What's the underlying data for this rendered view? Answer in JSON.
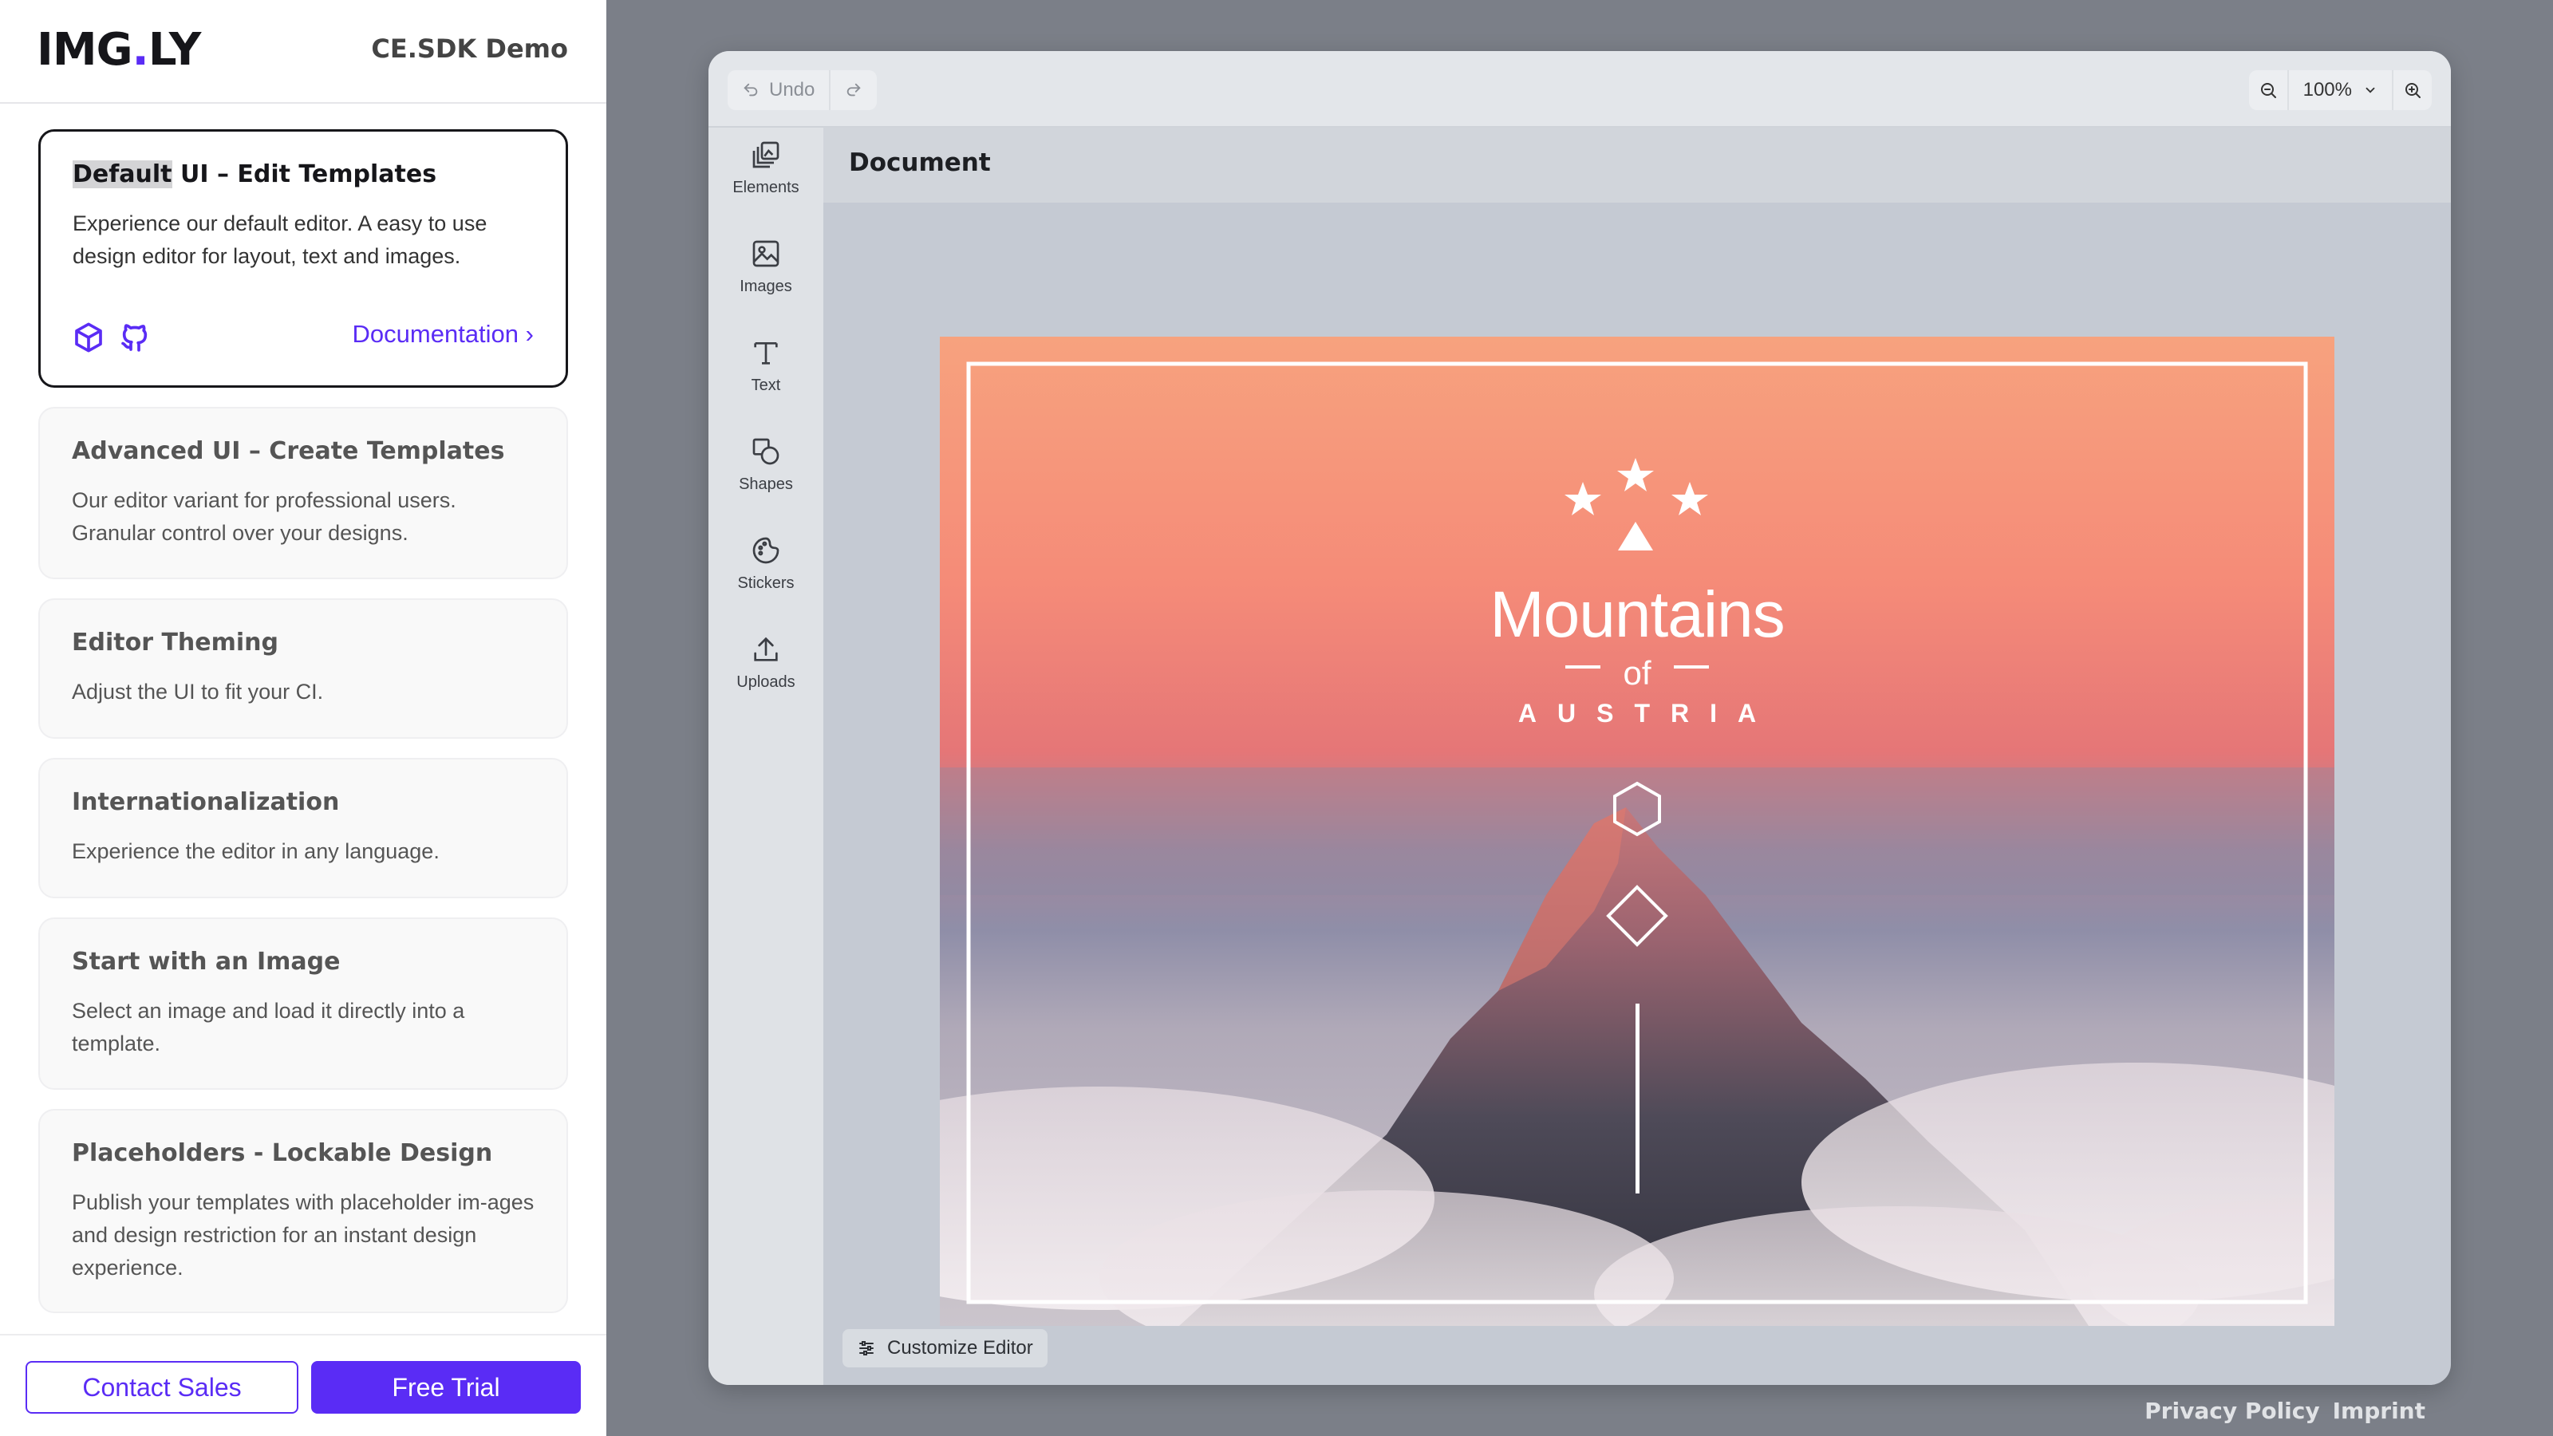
{
  "sidebar": {
    "logo": {
      "text_main": "IMG",
      "text_dot": ".",
      "text_end": "LY"
    },
    "demo_title": "CE.SDK Demo",
    "cards": [
      {
        "title_highlight": "Default",
        "title_rest": " UI – Edit Templates",
        "description": "Experience our default editor. A easy to use design editor for layout, text and images.",
        "link": "Documentation"
      },
      {
        "title": "Advanced UI – Create Templates",
        "description": "Our editor variant for professional users. Granular control over your designs."
      },
      {
        "title": "Editor Theming",
        "description": "Adjust the UI to fit your CI."
      },
      {
        "title": "Internationalization",
        "description": "Experience the editor in any language."
      },
      {
        "title": "Start with an Image",
        "description": "Select an image and load it directly into a template."
      },
      {
        "title": "Placeholders - Lockable Design",
        "description": "Publish your templates with placeholder im-ages and design restriction for an instant design experience."
      }
    ],
    "footer": {
      "contact": "Contact Sales",
      "trial": "Free Trial"
    }
  },
  "editor": {
    "undo_label": "Undo",
    "zoom_level": "100%",
    "dock": [
      "Elements",
      "Images",
      "Text",
      "Shapes",
      "Stickers",
      "Uploads"
    ],
    "document_title": "Document",
    "canvas": {
      "title": "Mountains",
      "of": "of",
      "subtitle": "AUSTRIA"
    },
    "customize_label": "Customize Editor"
  },
  "footer_links": {
    "privacy": "Privacy Policy",
    "imprint": "Imprint"
  },
  "colors": {
    "accent": "#5a2cf5",
    "background": "#7b7f88"
  }
}
